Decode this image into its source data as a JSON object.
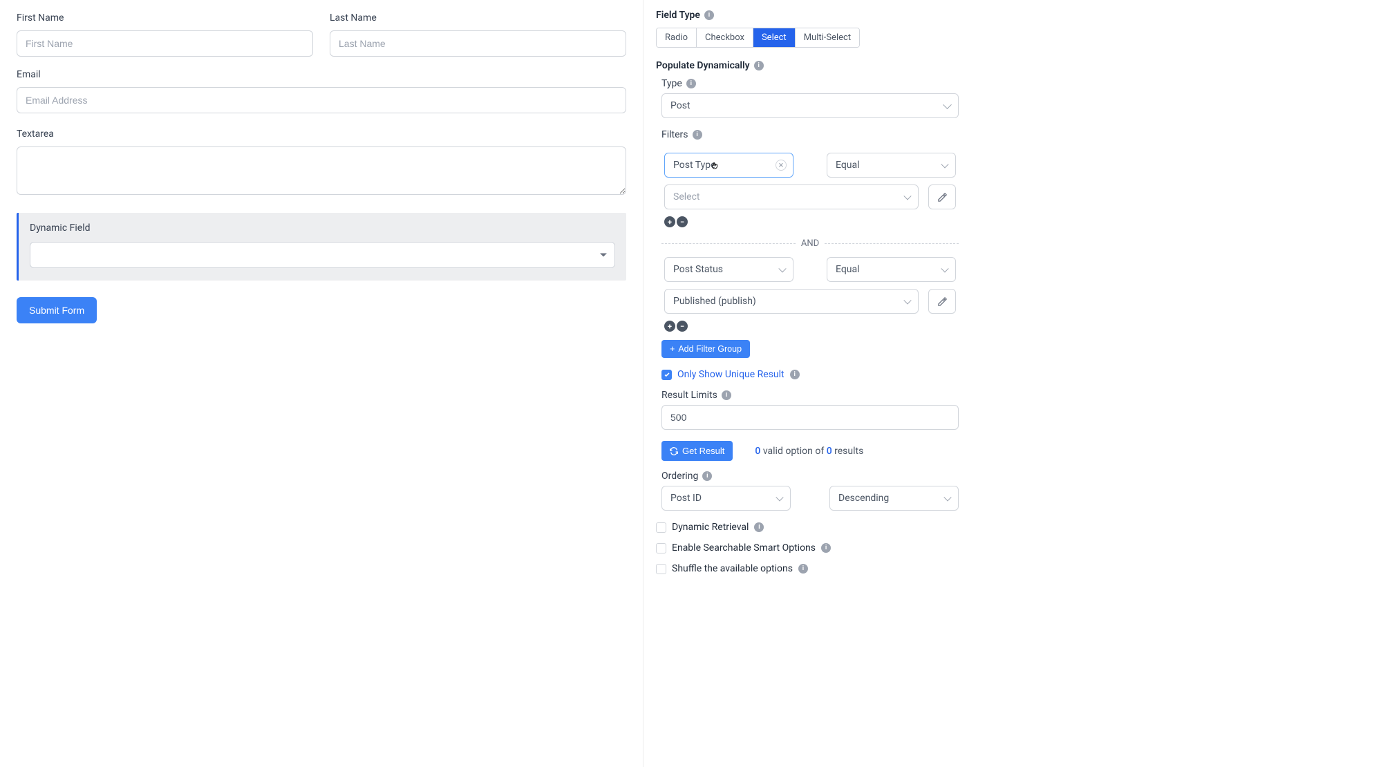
{
  "form": {
    "first_name": {
      "label": "First Name",
      "placeholder": "First Name"
    },
    "last_name": {
      "label": "Last Name",
      "placeholder": "Last Name"
    },
    "email": {
      "label": "Email",
      "placeholder": "Email Address"
    },
    "textarea": {
      "label": "Textarea"
    },
    "dynamic_field": {
      "label": "Dynamic Field"
    },
    "submit_label": "Submit Form"
  },
  "panel": {
    "field_type": {
      "header": "Field Type",
      "tabs": [
        "Radio",
        "Checkbox",
        "Select",
        "Multi-Select"
      ],
      "active": "Select"
    },
    "populate": {
      "header": "Populate Dynamically",
      "type_label": "Type",
      "type_value": "Post",
      "filters_label": "Filters",
      "filter1": {
        "field": "Post Type",
        "operator": "Equal",
        "value_placeholder": "Select"
      },
      "and_label": "AND",
      "filter2": {
        "field": "Post Status",
        "operator": "Equal",
        "value": "Published (publish)"
      },
      "add_filter_group": "Add Filter Group",
      "unique_result": "Only Show Unique Result",
      "result_limits_label": "Result Limits",
      "result_limits_value": "500",
      "get_result_label": "Get Result",
      "result_count1": "0",
      "result_middle": " valid option of ",
      "result_count2": "0",
      "result_tail": " results",
      "ordering_label": "Ordering",
      "ordering_field": "Post ID",
      "ordering_dir": "Descending",
      "dynamic_retrieval": "Dynamic Retrieval",
      "enable_searchable": "Enable Searchable Smart Options",
      "shuffle": "Shuffle the available options"
    }
  }
}
